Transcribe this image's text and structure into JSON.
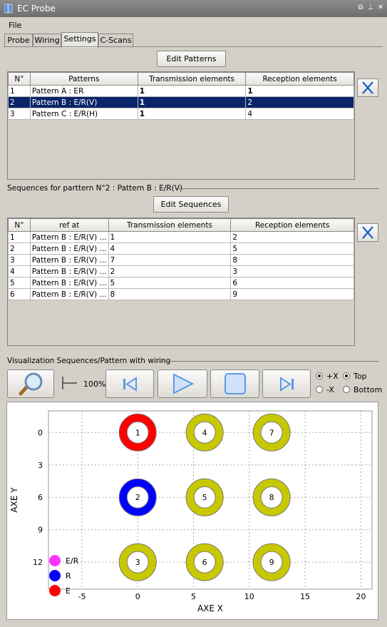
{
  "window": {
    "title": "EC Probe"
  },
  "menu": {
    "file": "File"
  },
  "tabs": [
    "Probe",
    "Wiring",
    "Settings",
    "C-Scans"
  ],
  "patterns": {
    "edit_button": "Edit Patterns",
    "headers": [
      "N°",
      "Patterns",
      "Transmission elements",
      "Reception  elements"
    ],
    "rows": [
      [
        "1",
        "Pattern A : ER",
        "1",
        "1"
      ],
      [
        "2",
        "Pattern B : E/R(V)",
        "1",
        "2"
      ],
      [
        "3",
        "Pattern C : E/R(H)",
        "1",
        "4"
      ]
    ],
    "selected_row": 1
  },
  "sequences": {
    "section_label": "Sequences for parttern N°2 : Pattern B : E/R(V)",
    "edit_button": "Edit Sequences",
    "headers": [
      "N°",
      "ref at",
      "Transmission elements",
      "Reception elements"
    ],
    "rows": [
      [
        "1",
        "Pattern B : E/R(V) ...",
        "1",
        "2"
      ],
      [
        "2",
        "Pattern B : E/R(V) ...",
        "4",
        "5"
      ],
      [
        "3",
        "Pattern B : E/R(V) ...",
        "7",
        "8"
      ],
      [
        "4",
        "Pattern B : E/R(V) ...",
        "2",
        "3"
      ],
      [
        "5",
        "Pattern B : E/R(V) ...",
        "5",
        "6"
      ],
      [
        "6",
        "Pattern B : E/R(V) ...",
        "8",
        "9"
      ]
    ]
  },
  "visualization": {
    "section_label": "Visualization Sequences/Pattern with wiring",
    "zoom_label": "100%",
    "radio_plusx": "+X",
    "radio_minusx": "-X",
    "radio_top": "Top",
    "radio_bottom": "Bottom"
  },
  "colors": {
    "emit": "#ff0000",
    "receive": "#0000ff",
    "er": "#ff33ff",
    "idle": "#c8c800",
    "selection": "#0a246a"
  },
  "chart_data": {
    "type": "scatter",
    "xlabel": "AXE X",
    "ylabel": "AXE Y",
    "xlim": [
      -8,
      21
    ],
    "ylim": [
      14.5,
      -2
    ],
    "x_ticks": [
      -5,
      0,
      5,
      10,
      15,
      20
    ],
    "y_ticks": [
      0,
      3,
      6,
      9,
      12
    ],
    "legend": [
      {
        "label": "E/R",
        "color": "#ff33ff"
      },
      {
        "label": "R",
        "color": "#0000ff"
      },
      {
        "label": "E",
        "color": "#ff0000"
      }
    ],
    "points": [
      {
        "label": "1",
        "x": 0,
        "y": 0,
        "role": "E"
      },
      {
        "label": "4",
        "x": 6,
        "y": 0,
        "role": "idle"
      },
      {
        "label": "7",
        "x": 12,
        "y": 0,
        "role": "idle"
      },
      {
        "label": "2",
        "x": 0,
        "y": 6,
        "role": "R"
      },
      {
        "label": "5",
        "x": 6,
        "y": 6,
        "role": "idle"
      },
      {
        "label": "8",
        "x": 12,
        "y": 6,
        "role": "idle"
      },
      {
        "label": "3",
        "x": 0,
        "y": 12,
        "role": "idle"
      },
      {
        "label": "6",
        "x": 6,
        "y": 12,
        "role": "idle"
      },
      {
        "label": "9",
        "x": 12,
        "y": 12,
        "role": "idle"
      }
    ]
  }
}
